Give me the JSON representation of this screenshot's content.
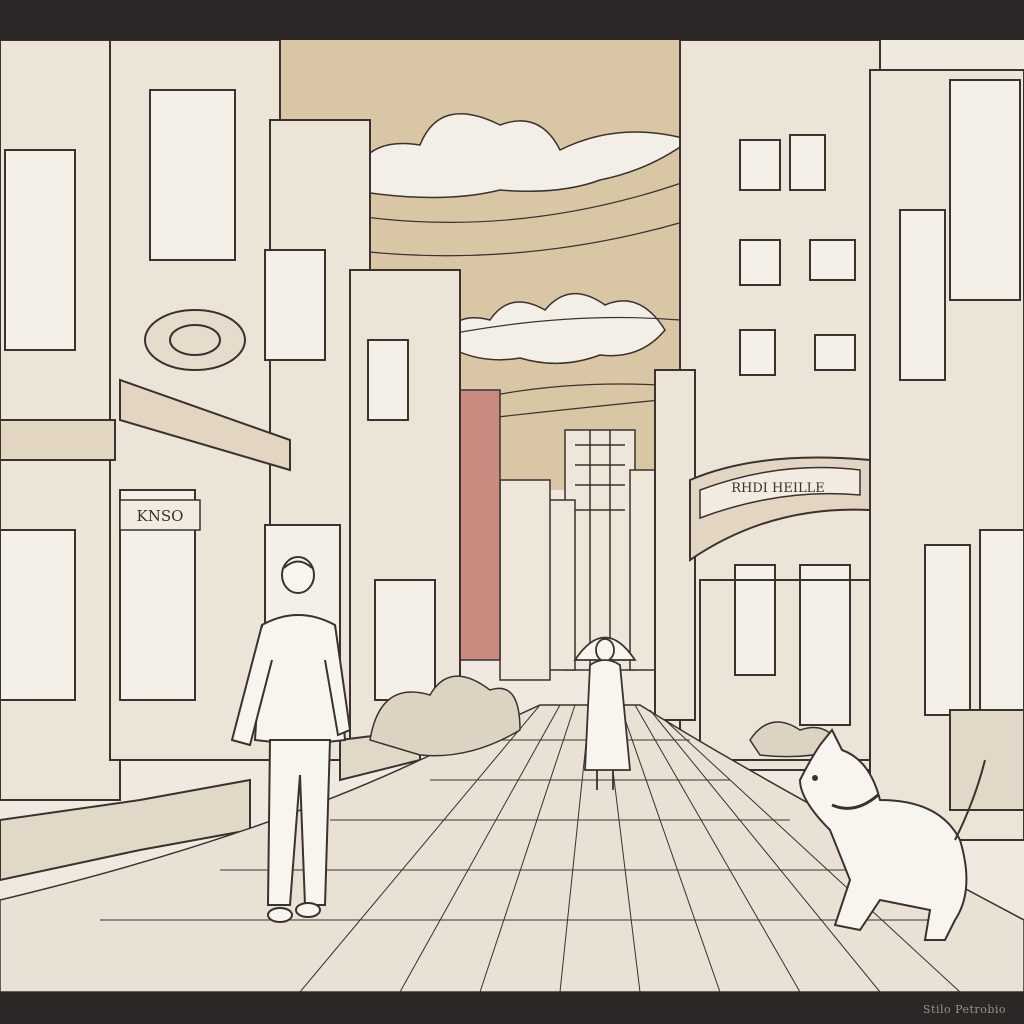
{
  "scene": {
    "kind": "illustration",
    "style": "line-art street scene",
    "frame_color": "#2a2726",
    "sky_color": "#d8c6a4",
    "paper_color": "#efe9df",
    "ink_color": "#3a3130"
  },
  "signs": {
    "left_shop": "KNSO",
    "right_banner": "RHDI HEILLE"
  },
  "signature": "Stilo Petrobio"
}
